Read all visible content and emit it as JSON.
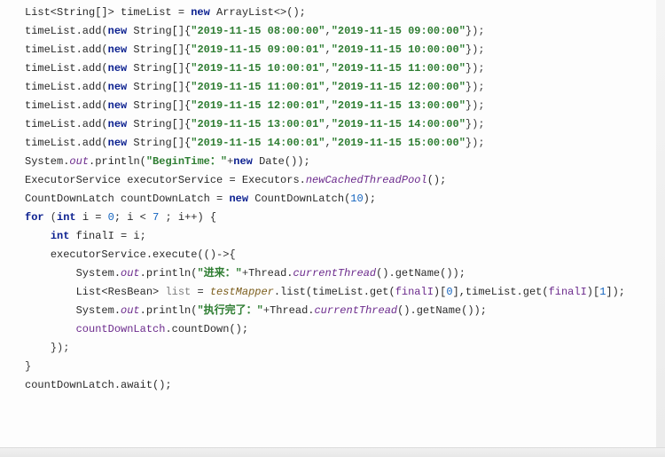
{
  "l1": {
    "a": "List<String[]> timeList = ",
    "kw": "new",
    "b": " ArrayList<>();"
  },
  "adds": [
    {
      "pre": "timeList.add(",
      "kw": "new",
      "mid": " String[]{",
      "s1": "\"2019-11-15 08:00:00\"",
      "comma": ",",
      "s2": "\"2019-11-15 09:00:00\"",
      "post": "});"
    },
    {
      "pre": "timeList.add(",
      "kw": "new",
      "mid": " String[]{",
      "s1": "\"2019-11-15 09:00:01\"",
      "comma": ",",
      "s2": "\"2019-11-15 10:00:00\"",
      "post": "});"
    },
    {
      "pre": "timeList.add(",
      "kw": "new",
      "mid": " String[]{",
      "s1": "\"2019-11-15 10:00:01\"",
      "comma": ",",
      "s2": "\"2019-11-15 11:00:00\"",
      "post": "});"
    },
    {
      "pre": "timeList.add(",
      "kw": "new",
      "mid": " String[]{",
      "s1": "\"2019-11-15 11:00:01\"",
      "comma": ",",
      "s2": "\"2019-11-15 12:00:00\"",
      "post": "});"
    },
    {
      "pre": "timeList.add(",
      "kw": "new",
      "mid": " String[]{",
      "s1": "\"2019-11-15 12:00:01\"",
      "comma": ",",
      "s2": "\"2019-11-15 13:00:00\"",
      "post": "});"
    },
    {
      "pre": "timeList.add(",
      "kw": "new",
      "mid": " String[]{",
      "s1": "\"2019-11-15 13:00:01\"",
      "comma": ",",
      "s2": "\"2019-11-15 14:00:00\"",
      "post": "});"
    },
    {
      "pre": "timeList.add(",
      "kw": "new",
      "mid": " String[]{",
      "s1": "\"2019-11-15 14:00:01\"",
      "comma": ",",
      "s2": "\"2019-11-15 15:00:00\"",
      "post": "});"
    }
  ],
  "blank": "",
  "l10": {
    "a": "System.",
    "out": "out",
    "b": ".println(",
    "s": "\"BeginTime：\"",
    "plus": "+",
    "kw": "new",
    "c": " Date());"
  },
  "l11": {
    "a": "ExecutorService executorService = Executors.",
    "m": "newCachedThreadPool",
    "b": "();"
  },
  "l12": {
    "a": "CountDownLatch countDownLatch = ",
    "kw": "new",
    "b": " CountDownLatch(",
    "n": "10",
    "c": ");"
  },
  "l13": {
    "kwfor": "for",
    "a": " (",
    "kwint": "int",
    "b": " i = ",
    "n0": "0",
    "c": "; i < ",
    "n7": "7",
    "d": " ; i++) {"
  },
  "l14": {
    "indent": "    ",
    "kwint": "int",
    "b": " finalI = i;"
  },
  "l15": {
    "indent": "    ",
    "a": "executorService.execute(()->{"
  },
  "l16": {
    "indent": "        ",
    "a": "System.",
    "out": "out",
    "b": ".println(",
    "s": "\"进来：\"",
    "plus": "+",
    "c": "Thread.",
    "m": "currentThread",
    "d": "().getName());"
  },
  "l17": {
    "indent": "        ",
    "a": "List<ResBean> ",
    "listv": "list",
    "b": " = ",
    "mapper": "testMapper",
    "c": ".list(timeList.get(",
    "fI1": "finalI",
    "d": ")[",
    "n0a": "0",
    "e": "],timeList.get(",
    "fI2": "finalI",
    "f": ")[",
    "n1": "1",
    "g": "]);"
  },
  "l18": {
    "indent": "        ",
    "a": "System.",
    "out": "out",
    "b": ".println(",
    "s": "\"执行完了：\"",
    "plus": "+",
    "c": "Thread.",
    "m": "currentThread",
    "d": "().getName());"
  },
  "l19": {
    "indent": "        ",
    "cdl": "countDownLatch",
    "b": ".countDown();"
  },
  "l20": {
    "indent": "    ",
    "a": "});"
  },
  "l21": {
    "a": "}"
  },
  "l22": {
    "a": "countDownLatch.await();"
  }
}
